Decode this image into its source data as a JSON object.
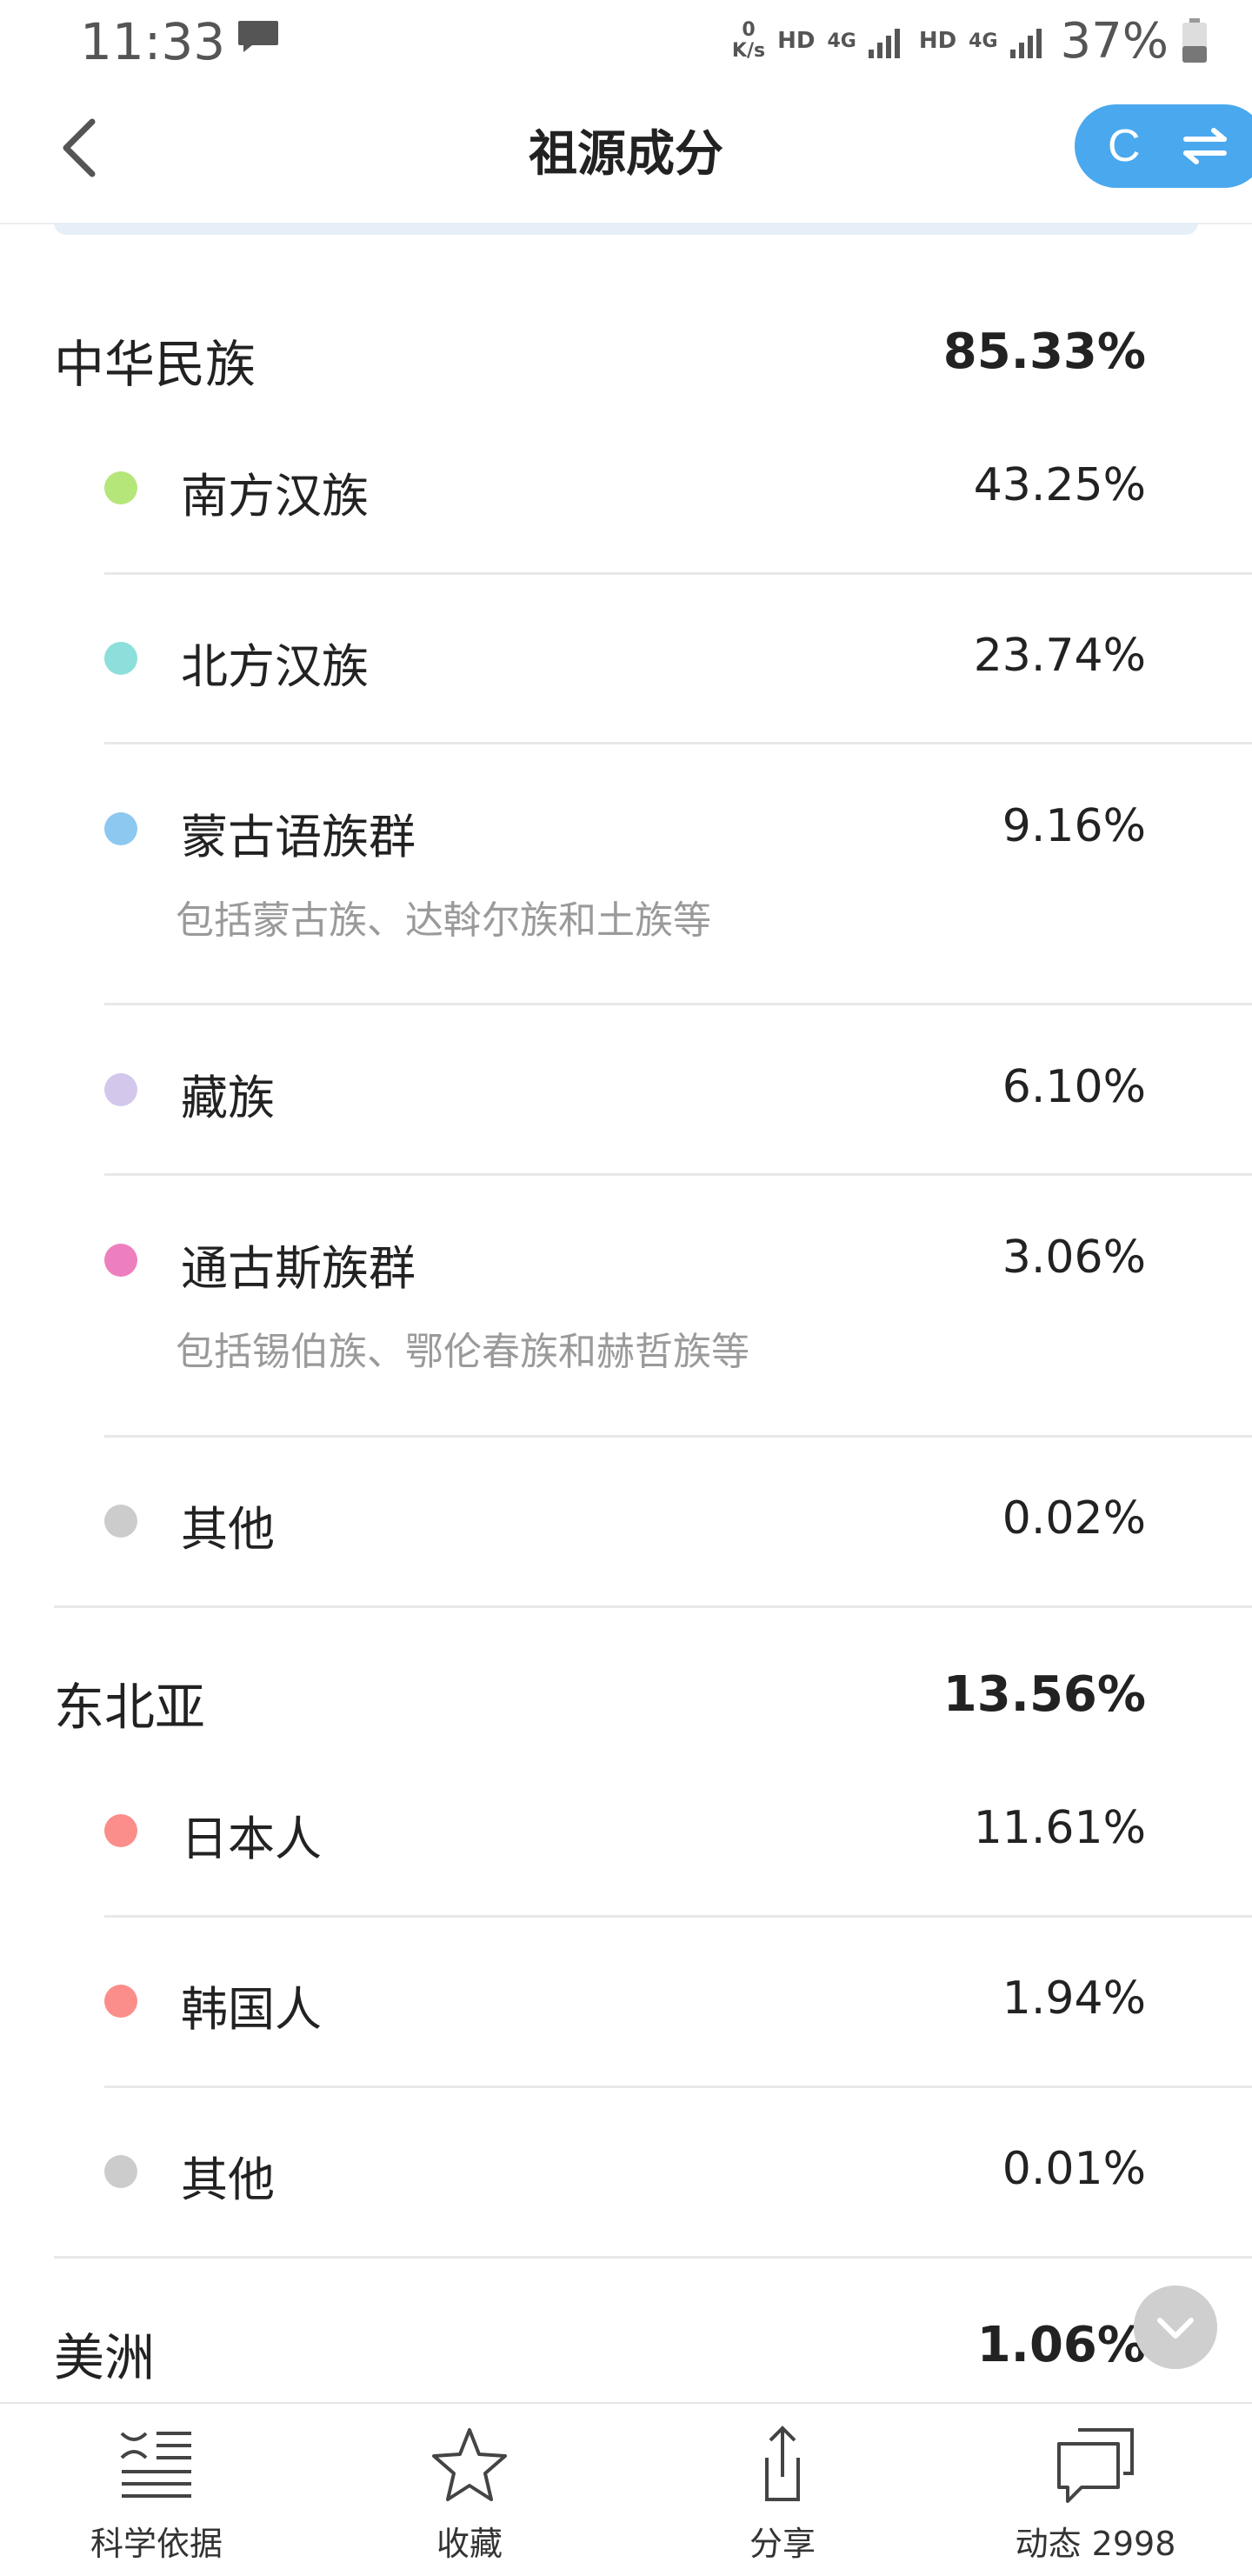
{
  "status_bar": {
    "time": "11:33",
    "net_speed_value": "0",
    "net_speed_unit": "K/s",
    "hd1": "HD",
    "net1": "4G",
    "hd2": "HD",
    "net2": "4G",
    "battery": "37%"
  },
  "header": {
    "title": "祖源成分",
    "switch_letter": "C"
  },
  "groups": [
    {
      "name": "中华民族",
      "percent": "85.33%",
      "items": [
        {
          "name": "南方汉族",
          "percent": "43.25%",
          "color": "#b5e67a"
        },
        {
          "name": "北方汉族",
          "percent": "23.74%",
          "color": "#8ddfdb"
        },
        {
          "name": "蒙古语族群",
          "percent": "9.16%",
          "color": "#8cc8f0",
          "desc": "包括蒙古族、达斡尔族和土族等"
        },
        {
          "name": "藏族",
          "percent": "6.10%",
          "color": "#d3c8ec"
        },
        {
          "name": "通古斯族群",
          "percent": "3.06%",
          "color": "#ee7fbe",
          "desc": "包括锡伯族、鄂伦春族和赫哲族等"
        },
        {
          "name": "其他",
          "percent": "0.02%",
          "color": "#cccccc"
        }
      ]
    },
    {
      "name": "东北亚",
      "percent": "13.56%",
      "items": [
        {
          "name": "日本人",
          "percent": "11.61%",
          "color": "#fb8d8a"
        },
        {
          "name": "韩国人",
          "percent": "1.94%",
          "color": "#fb8d8a"
        },
        {
          "name": "其他",
          "percent": "0.01%",
          "color": "#cccccc"
        }
      ]
    },
    {
      "name": "美洲",
      "percent": "1.06%"
    }
  ],
  "bottom_nav": [
    {
      "label": "科学依据",
      "icon": "science-basis-icon"
    },
    {
      "label": "收藏",
      "icon": "star-icon"
    },
    {
      "label": "分享",
      "icon": "share-icon"
    },
    {
      "label": "动态 2998",
      "icon": "comments-icon"
    }
  ]
}
